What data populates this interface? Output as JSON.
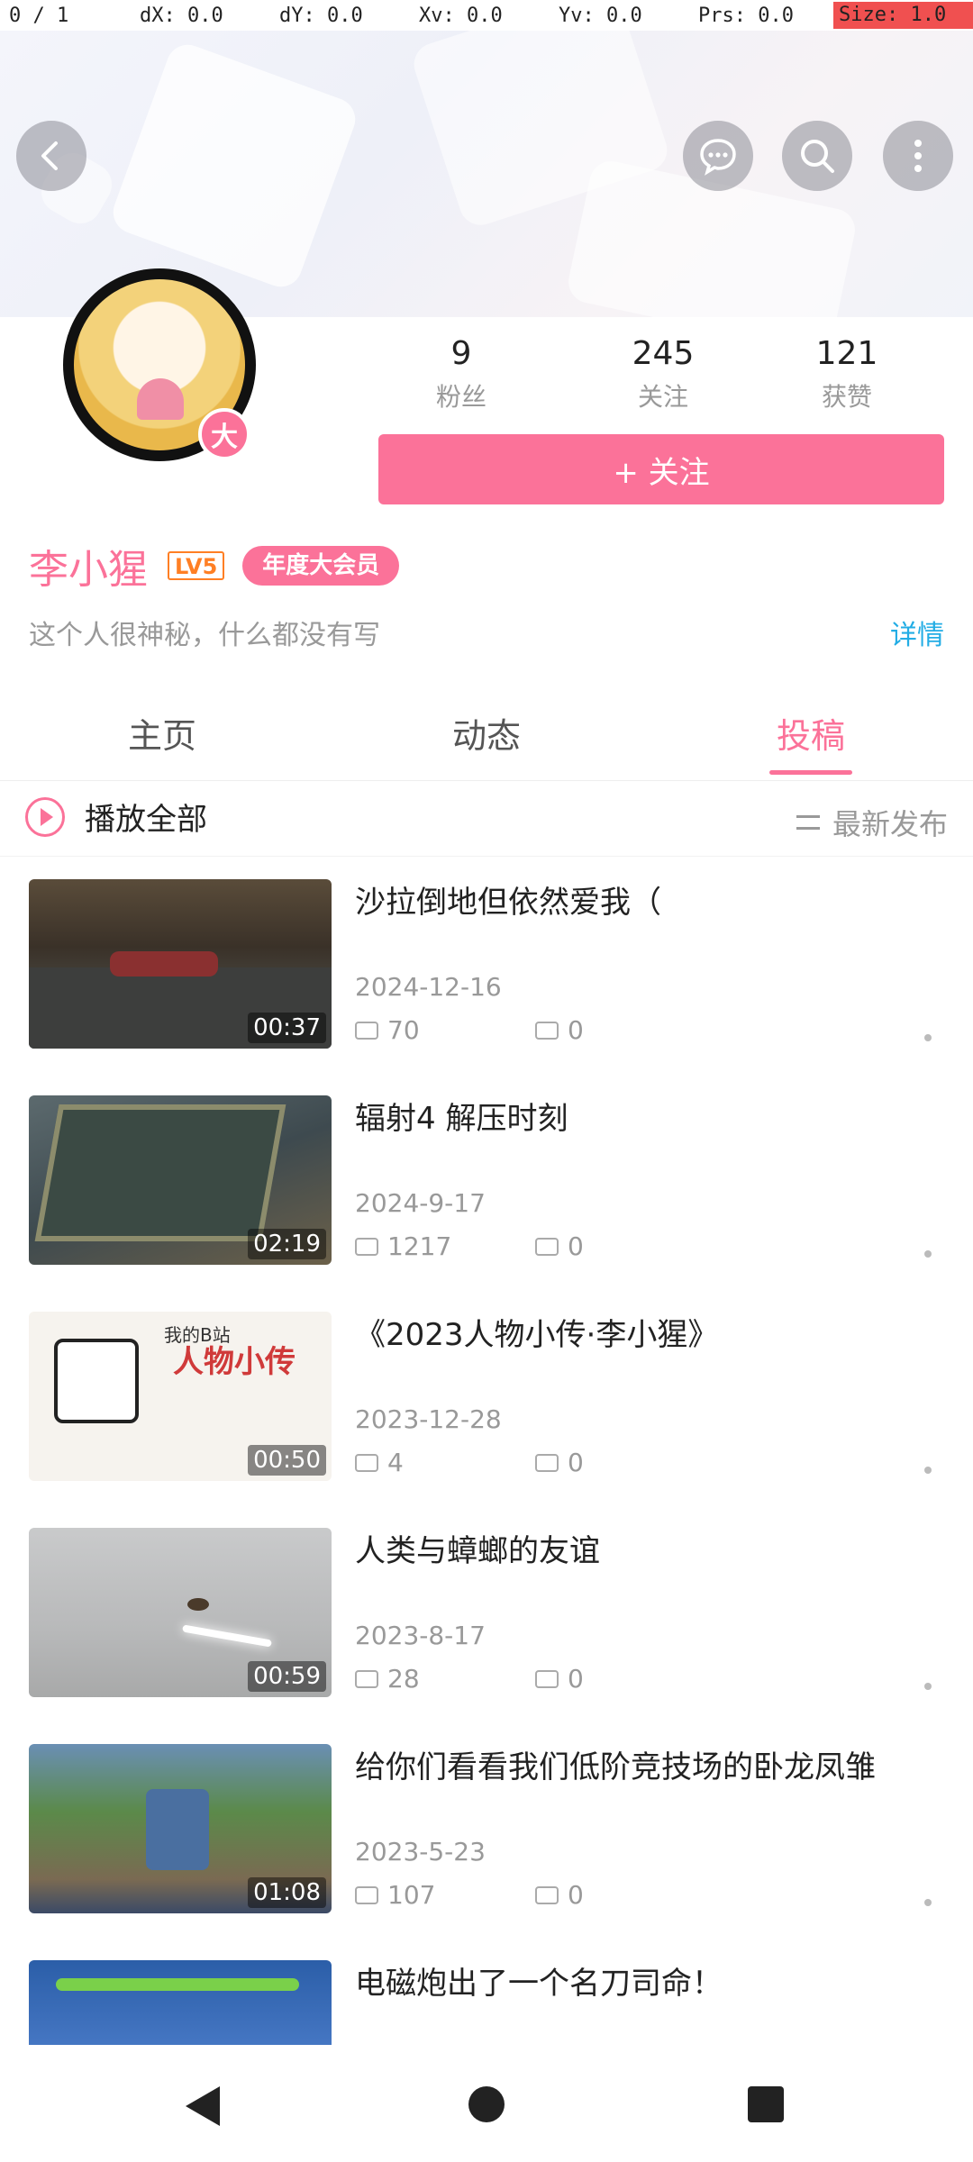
{
  "debug": {
    "pointer": "0 / 1",
    "dx": "dX: 0.0",
    "dy": "dY: 0.0",
    "xv": "Xv: 0.0",
    "yv": "Yv: 0.0",
    "prs": "Prs: 0.0",
    "size": "Size: 1.0"
  },
  "header": {
    "back_icon": "chevron-left-icon",
    "message_icon": "chat-bubble-icon",
    "search_icon": "search-icon",
    "more_icon": "more-vertical-icon"
  },
  "profile": {
    "avatar_badge": "大",
    "stats": [
      {
        "value": "9",
        "label": "粉丝"
      },
      {
        "value": "245",
        "label": "关注"
      },
      {
        "value": "121",
        "label": "获赞"
      }
    ],
    "follow_label": "+ 关注",
    "name": "李小猩",
    "level": "LV5",
    "vip": "年度大会员",
    "bio": "这个人很神秘，什么都没有写",
    "detail_label": "详情"
  },
  "tabs": [
    {
      "label": "主页",
      "active": false
    },
    {
      "label": "动态",
      "active": false
    },
    {
      "label": "投稿",
      "active": true
    }
  ],
  "toolbar": {
    "play_all": "播放全部",
    "sort": "最新发布"
  },
  "videos": [
    {
      "title": "沙拉倒地但依然爱我（",
      "date": "2024-12-16",
      "views": "70",
      "comments": "0",
      "duration": "00:37"
    },
    {
      "title": "辐射4 解压时刻",
      "date": "2024-9-17",
      "views": "1217",
      "comments": "0",
      "duration": "02:19"
    },
    {
      "title": "《2023人物小传·李小猩》",
      "date": "2023-12-28",
      "views": "4",
      "comments": "0",
      "duration": "00:50",
      "thumb_title": "人物小传",
      "thumb_sub": "我的B站"
    },
    {
      "title": "人类与蟑螂的友谊",
      "date": "2023-8-17",
      "views": "28",
      "comments": "0",
      "duration": "00:59"
    },
    {
      "title": "给你们看看我们低阶竞技场的卧龙凤雏",
      "date": "2023-5-23",
      "views": "107",
      "comments": "0",
      "duration": "01:08"
    },
    {
      "title": "电磁炮出了一个名刀司命！",
      "date": "",
      "views": "",
      "comments": "",
      "duration": ""
    }
  ],
  "colors": {
    "accent": "#fb7299",
    "link": "#23ade5",
    "level": "#ff7f24"
  }
}
